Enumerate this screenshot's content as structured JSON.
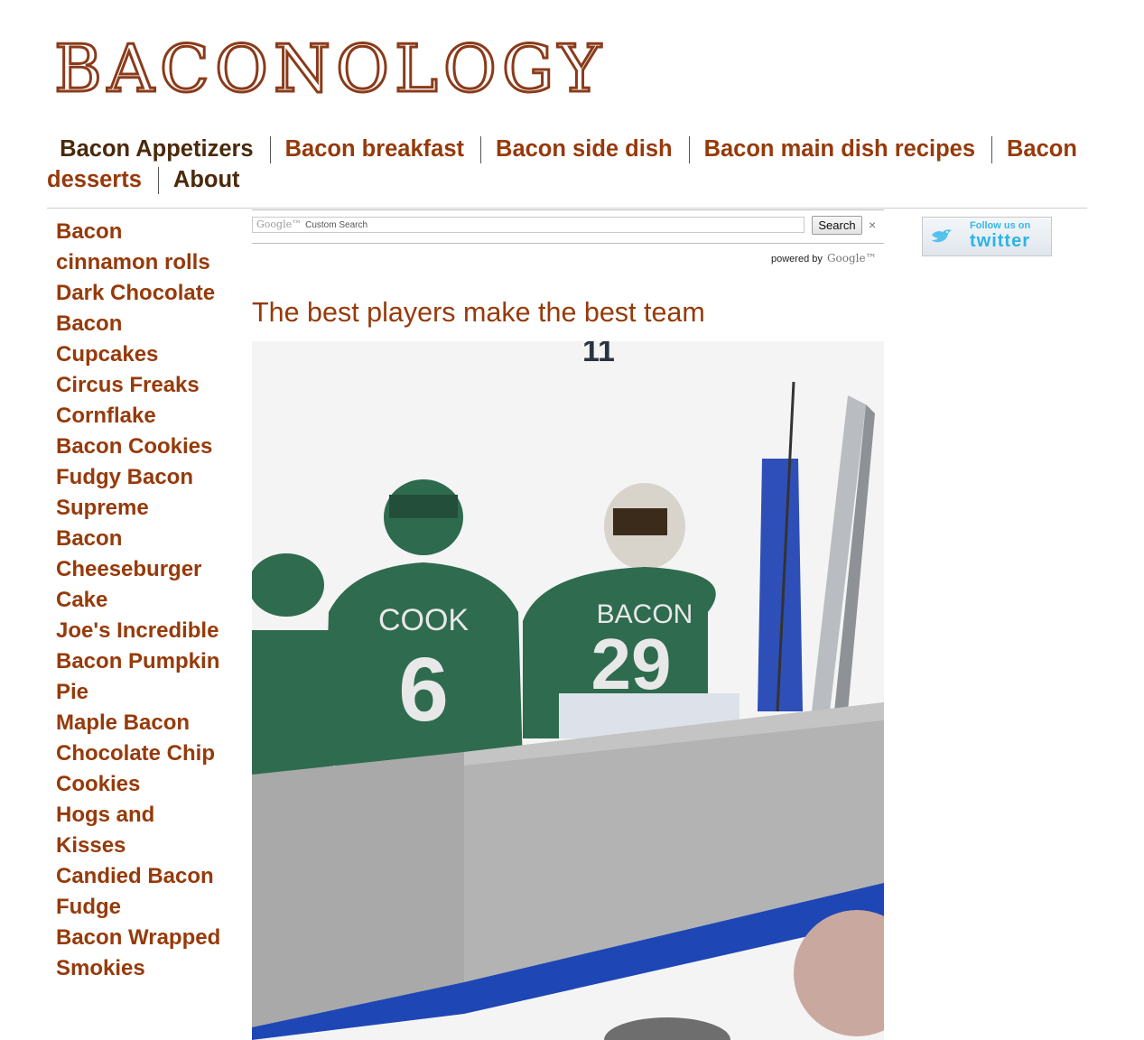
{
  "site": {
    "logo_text": "BACONOLOGY"
  },
  "topnav": {
    "items": [
      {
        "label": "Bacon Appetizers"
      },
      {
        "label": "Bacon breakfast"
      },
      {
        "label": "Bacon side dish"
      },
      {
        "label": "Bacon main dish recipes"
      },
      {
        "label": "Bacon desserts"
      },
      {
        "label": "About"
      }
    ]
  },
  "sidebar": {
    "items": [
      {
        "label": "Bacon cinnamon rolls"
      },
      {
        "label": "Dark Chocolate Bacon Cupcakes"
      },
      {
        "label": "Circus Freaks Cornflake Bacon Cookies"
      },
      {
        "label": "Fudgy Bacon Supreme"
      },
      {
        "label": "Bacon Cheeseburger Cake"
      },
      {
        "label": "Joe's Incredible Bacon Pumpkin Pie"
      },
      {
        "label": "Maple Bacon Chocolate Chip Cookies"
      },
      {
        "label": "Hogs and Kisses"
      },
      {
        "label": "Candied Bacon Fudge"
      },
      {
        "label": "Bacon Wrapped Smokies"
      }
    ]
  },
  "search": {
    "google_label": "Google™",
    "placeholder": "Custom Search",
    "button_label": "Search",
    "clear_symbol": "×",
    "powered_by": "powered by",
    "powered_logo": "Google™"
  },
  "twitter": {
    "follow_text": "Follow us on",
    "brand": "twitter"
  },
  "post": {
    "title": "The best players make the best team",
    "photo_jerseys": [
      {
        "name": "COOK",
        "number": "6"
      },
      {
        "name": "BACON",
        "number": "29"
      }
    ],
    "photo_overhead_mark": "11"
  },
  "colors": {
    "link": "#963a0a",
    "logo": "#8a3b1a",
    "twitter": "#2db3e6",
    "jersey": "#2f6b4f"
  }
}
